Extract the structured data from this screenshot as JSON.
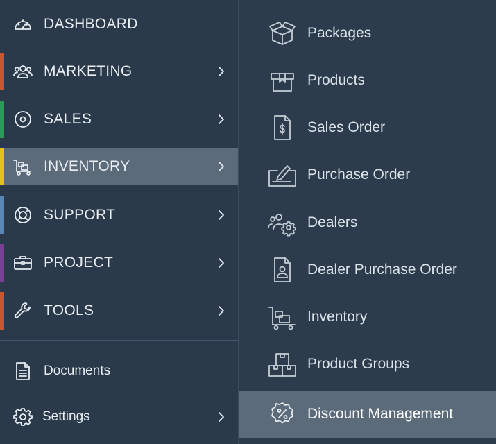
{
  "nav": {
    "items": [
      {
        "label": "DASHBOARD",
        "icon": "speedometer-icon",
        "accent": null
      },
      {
        "label": "MARKETING",
        "icon": "people-icon",
        "accent": "#c8552b"
      },
      {
        "label": "SALES",
        "icon": "target-icon",
        "accent": "#2e9a5a"
      },
      {
        "label": "INVENTORY",
        "icon": "cart-boxes-icon",
        "accent": "#e3c21b",
        "active": true
      },
      {
        "label": "SUPPORT",
        "icon": "lifebuoy-icon",
        "accent": "#5a86b5"
      },
      {
        "label": "PROJECT",
        "icon": "briefcase-icon",
        "accent": "#7a3f97"
      },
      {
        "label": "TOOLS",
        "icon": "wrench-icon",
        "accent": "#c8552b"
      }
    ],
    "bottom": [
      {
        "label": "Documents",
        "icon": "document-icon"
      },
      {
        "label": "Settings",
        "icon": "gear-icon"
      }
    ]
  },
  "submenu": {
    "items": [
      {
        "label": "Packages",
        "icon": "open-box-icon"
      },
      {
        "label": "Products",
        "icon": "box-icon"
      },
      {
        "label": "Sales Order",
        "icon": "dollar-document-icon"
      },
      {
        "label": "Purchase Order",
        "icon": "pencil-signature-icon"
      },
      {
        "label": "Dealers",
        "icon": "people-gear-icon"
      },
      {
        "label": "Dealer Purchase Order",
        "icon": "person-document-icon"
      },
      {
        "label": "Inventory",
        "icon": "cart-boxes-icon"
      },
      {
        "label": "Product Groups",
        "icon": "stacked-boxes-icon"
      },
      {
        "label": "Discount Management",
        "icon": "percent-badge-icon",
        "active": true
      }
    ]
  }
}
